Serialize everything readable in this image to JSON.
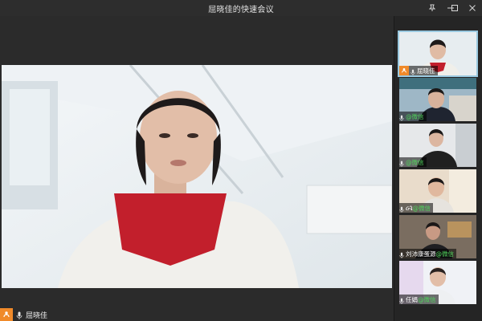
{
  "window": {
    "title": "屈晓佳的快速会议",
    "controls": [
      "pin-icon",
      "minimize-icon",
      "maximize-icon",
      "close-icon"
    ]
  },
  "main_video": {
    "participant_name": "屈晓佳",
    "accent_color": "#f08a2a"
  },
  "participants": [
    {
      "name": "屈晓佳",
      "suffix": "",
      "active": true,
      "speaker_icon": true
    },
    {
      "name": "",
      "suffix": "@微信",
      "active": false,
      "speaker_icon": false
    },
    {
      "name": "",
      "suffix": "@微信",
      "active": false,
      "speaker_icon": false
    },
    {
      "name": "ᏵᎸ",
      "suffix": "@微信",
      "active": false,
      "speaker_icon": false
    },
    {
      "name": "刘沛康蛋源",
      "suffix": "@微信",
      "active": false,
      "speaker_icon": false
    },
    {
      "name": "任娟",
      "suffix": "@微信",
      "active": false,
      "speaker_icon": false
    }
  ]
}
